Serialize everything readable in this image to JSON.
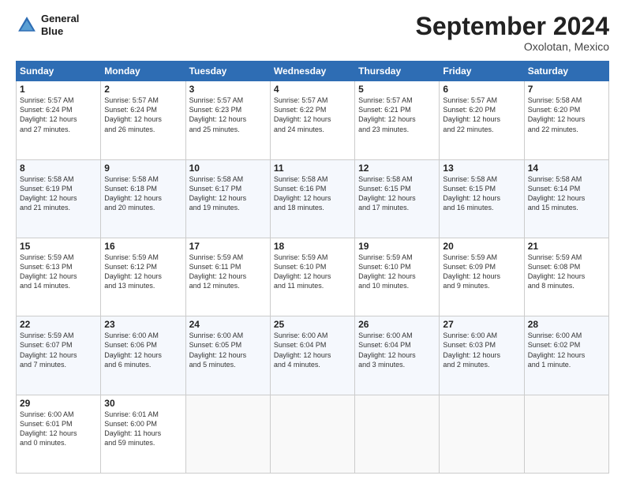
{
  "logo": {
    "line1": "General",
    "line2": "Blue"
  },
  "header": {
    "month_title": "September 2024",
    "subtitle": "Oxolotan, Mexico"
  },
  "weekdays": [
    "Sunday",
    "Monday",
    "Tuesday",
    "Wednesday",
    "Thursday",
    "Friday",
    "Saturday"
  ],
  "weeks": [
    [
      {
        "day": "1",
        "info": "Sunrise: 5:57 AM\nSunset: 6:24 PM\nDaylight: 12 hours\nand 27 minutes."
      },
      {
        "day": "2",
        "info": "Sunrise: 5:57 AM\nSunset: 6:24 PM\nDaylight: 12 hours\nand 26 minutes."
      },
      {
        "day": "3",
        "info": "Sunrise: 5:57 AM\nSunset: 6:23 PM\nDaylight: 12 hours\nand 25 minutes."
      },
      {
        "day": "4",
        "info": "Sunrise: 5:57 AM\nSunset: 6:22 PM\nDaylight: 12 hours\nand 24 minutes."
      },
      {
        "day": "5",
        "info": "Sunrise: 5:57 AM\nSunset: 6:21 PM\nDaylight: 12 hours\nand 23 minutes."
      },
      {
        "day": "6",
        "info": "Sunrise: 5:57 AM\nSunset: 6:20 PM\nDaylight: 12 hours\nand 22 minutes."
      },
      {
        "day": "7",
        "info": "Sunrise: 5:58 AM\nSunset: 6:20 PM\nDaylight: 12 hours\nand 22 minutes."
      }
    ],
    [
      {
        "day": "8",
        "info": "Sunrise: 5:58 AM\nSunset: 6:19 PM\nDaylight: 12 hours\nand 21 minutes."
      },
      {
        "day": "9",
        "info": "Sunrise: 5:58 AM\nSunset: 6:18 PM\nDaylight: 12 hours\nand 20 minutes."
      },
      {
        "day": "10",
        "info": "Sunrise: 5:58 AM\nSunset: 6:17 PM\nDaylight: 12 hours\nand 19 minutes."
      },
      {
        "day": "11",
        "info": "Sunrise: 5:58 AM\nSunset: 6:16 PM\nDaylight: 12 hours\nand 18 minutes."
      },
      {
        "day": "12",
        "info": "Sunrise: 5:58 AM\nSunset: 6:15 PM\nDaylight: 12 hours\nand 17 minutes."
      },
      {
        "day": "13",
        "info": "Sunrise: 5:58 AM\nSunset: 6:15 PM\nDaylight: 12 hours\nand 16 minutes."
      },
      {
        "day": "14",
        "info": "Sunrise: 5:58 AM\nSunset: 6:14 PM\nDaylight: 12 hours\nand 15 minutes."
      }
    ],
    [
      {
        "day": "15",
        "info": "Sunrise: 5:59 AM\nSunset: 6:13 PM\nDaylight: 12 hours\nand 14 minutes."
      },
      {
        "day": "16",
        "info": "Sunrise: 5:59 AM\nSunset: 6:12 PM\nDaylight: 12 hours\nand 13 minutes."
      },
      {
        "day": "17",
        "info": "Sunrise: 5:59 AM\nSunset: 6:11 PM\nDaylight: 12 hours\nand 12 minutes."
      },
      {
        "day": "18",
        "info": "Sunrise: 5:59 AM\nSunset: 6:10 PM\nDaylight: 12 hours\nand 11 minutes."
      },
      {
        "day": "19",
        "info": "Sunrise: 5:59 AM\nSunset: 6:10 PM\nDaylight: 12 hours\nand 10 minutes."
      },
      {
        "day": "20",
        "info": "Sunrise: 5:59 AM\nSunset: 6:09 PM\nDaylight: 12 hours\nand 9 minutes."
      },
      {
        "day": "21",
        "info": "Sunrise: 5:59 AM\nSunset: 6:08 PM\nDaylight: 12 hours\nand 8 minutes."
      }
    ],
    [
      {
        "day": "22",
        "info": "Sunrise: 5:59 AM\nSunset: 6:07 PM\nDaylight: 12 hours\nand 7 minutes."
      },
      {
        "day": "23",
        "info": "Sunrise: 6:00 AM\nSunset: 6:06 PM\nDaylight: 12 hours\nand 6 minutes."
      },
      {
        "day": "24",
        "info": "Sunrise: 6:00 AM\nSunset: 6:05 PM\nDaylight: 12 hours\nand 5 minutes."
      },
      {
        "day": "25",
        "info": "Sunrise: 6:00 AM\nSunset: 6:04 PM\nDaylight: 12 hours\nand 4 minutes."
      },
      {
        "day": "26",
        "info": "Sunrise: 6:00 AM\nSunset: 6:04 PM\nDaylight: 12 hours\nand 3 minutes."
      },
      {
        "day": "27",
        "info": "Sunrise: 6:00 AM\nSunset: 6:03 PM\nDaylight: 12 hours\nand 2 minutes."
      },
      {
        "day": "28",
        "info": "Sunrise: 6:00 AM\nSunset: 6:02 PM\nDaylight: 12 hours\nand 1 minute."
      }
    ],
    [
      {
        "day": "29",
        "info": "Sunrise: 6:00 AM\nSunset: 6:01 PM\nDaylight: 12 hours\nand 0 minutes."
      },
      {
        "day": "30",
        "info": "Sunrise: 6:01 AM\nSunset: 6:00 PM\nDaylight: 11 hours\nand 59 minutes."
      },
      {
        "day": "",
        "info": ""
      },
      {
        "day": "",
        "info": ""
      },
      {
        "day": "",
        "info": ""
      },
      {
        "day": "",
        "info": ""
      },
      {
        "day": "",
        "info": ""
      }
    ]
  ]
}
